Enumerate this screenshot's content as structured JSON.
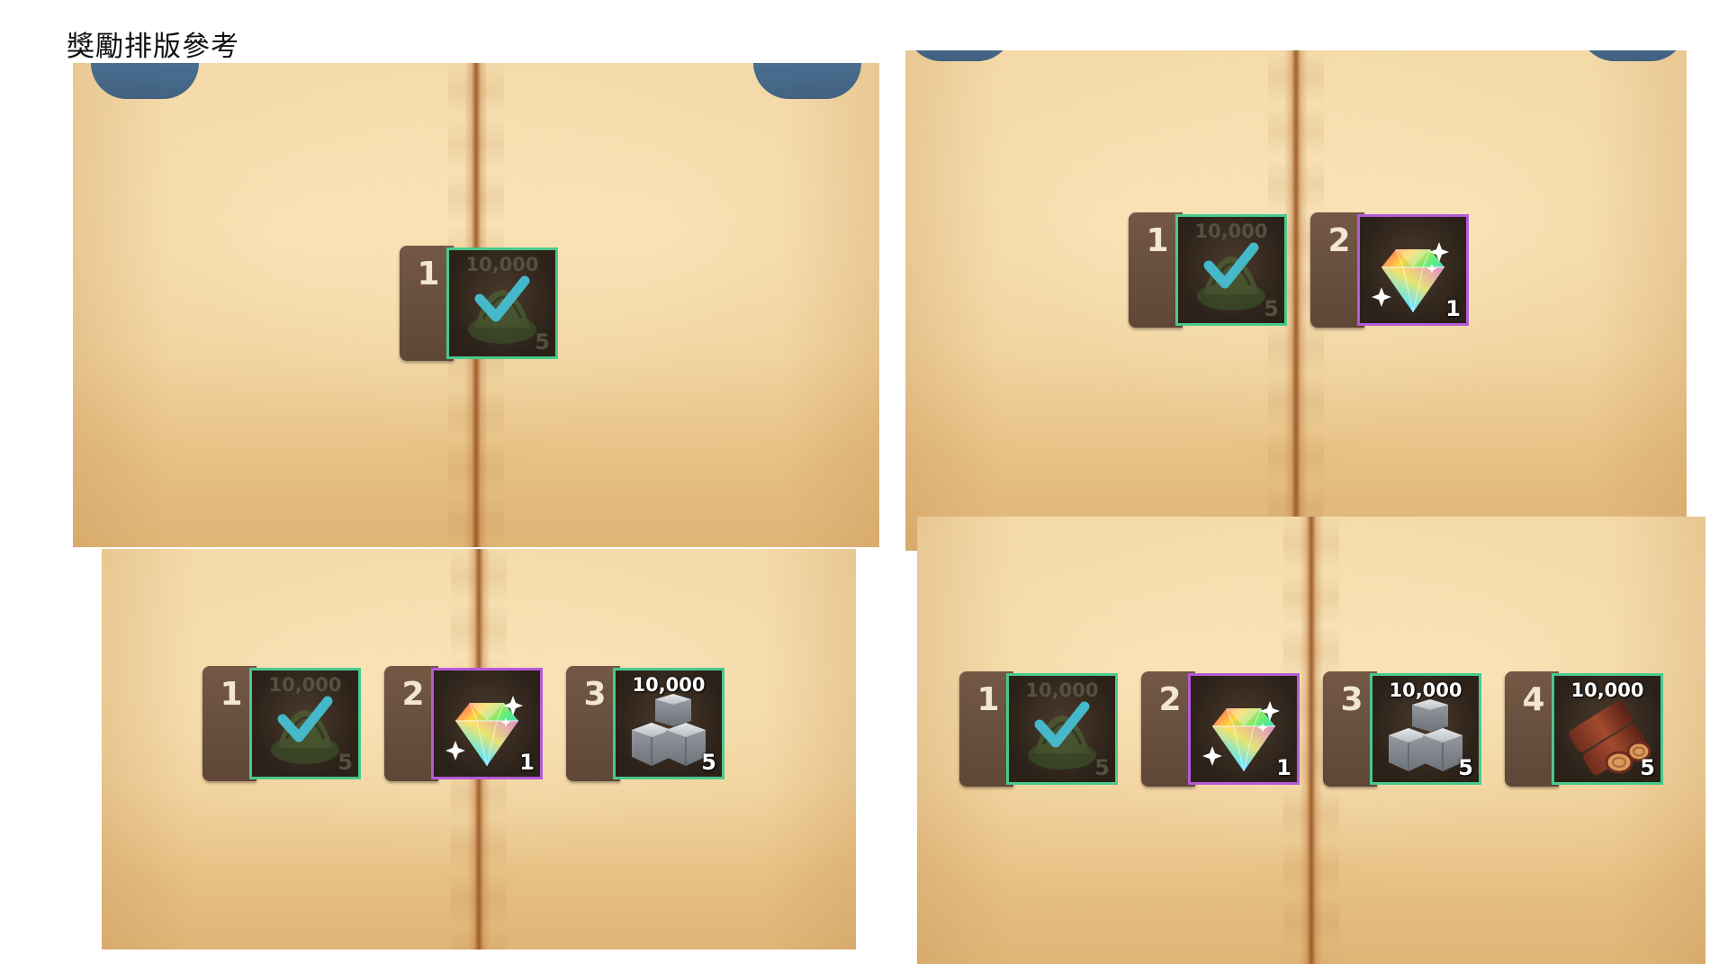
{
  "page": {
    "title": "獎勵排版參考"
  },
  "colors": {
    "claimed_border": "#49c98d",
    "epic_border": "#b45bd8",
    "index_tab": "#6a4f3e",
    "check": "#45b8c9"
  },
  "layouts": [
    {
      "rewards": [
        {
          "index": "1",
          "top": "10,000",
          "count": "5",
          "icon": "coin-pile-icon",
          "claimed": true
        }
      ]
    },
    {
      "rewards": [
        {
          "index": "1",
          "top": "10,000",
          "count": "5",
          "icon": "coin-pile-icon",
          "claimed": true
        },
        {
          "index": "2",
          "top": "",
          "count": "1",
          "icon": "rainbow-diamond-icon",
          "claimed": false
        }
      ]
    },
    {
      "rewards": [
        {
          "index": "1",
          "top": "10,000",
          "count": "5",
          "icon": "coin-pile-icon",
          "claimed": true
        },
        {
          "index": "2",
          "top": "",
          "count": "1",
          "icon": "rainbow-diamond-icon",
          "claimed": false
        },
        {
          "index": "3",
          "top": "10,000",
          "count": "5",
          "icon": "stone-blocks-icon",
          "claimed": false
        }
      ]
    },
    {
      "rewards": [
        {
          "index": "1",
          "top": "10,000",
          "count": "5",
          "icon": "coin-pile-icon",
          "claimed": true
        },
        {
          "index": "2",
          "top": "",
          "count": "1",
          "icon": "rainbow-diamond-icon",
          "claimed": false
        },
        {
          "index": "3",
          "top": "10,000",
          "count": "5",
          "icon": "stone-blocks-icon",
          "claimed": false
        },
        {
          "index": "4",
          "top": "10,000",
          "count": "5",
          "icon": "wood-logs-icon",
          "claimed": false
        }
      ]
    }
  ]
}
